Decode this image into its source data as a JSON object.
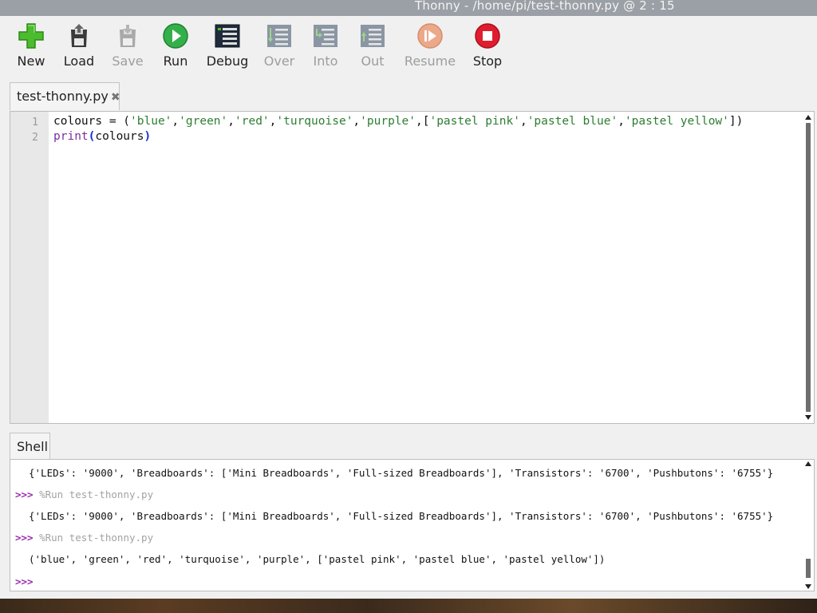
{
  "window": {
    "title": "Thonny  -  /home/pi/test-thonny.py  @  2 : 15"
  },
  "toolbar": {
    "buttons": [
      {
        "label": "New",
        "icon": "new-file-icon",
        "enabled": true
      },
      {
        "label": "Load",
        "icon": "load-icon",
        "enabled": true
      },
      {
        "label": "Save",
        "icon": "save-icon",
        "enabled": false
      },
      {
        "label": "Run",
        "icon": "run-icon",
        "enabled": true
      },
      {
        "label": "Debug",
        "icon": "debug-icon",
        "enabled": true
      },
      {
        "label": "Over",
        "icon": "step-over-icon",
        "enabled": false
      },
      {
        "label": "Into",
        "icon": "step-into-icon",
        "enabled": false
      },
      {
        "label": "Out",
        "icon": "step-out-icon",
        "enabled": false
      },
      {
        "label": "Resume",
        "icon": "resume-icon",
        "enabled": false
      },
      {
        "label": "Stop",
        "icon": "stop-icon",
        "enabled": true
      }
    ]
  },
  "editor": {
    "tab": {
      "label": "test-thonny.py",
      "close_glyph": "✖"
    },
    "lines": [
      {
        "number": "1",
        "text": "colours = ('blue','green','red','turquoise','purple',['pastel pink','pastel blue','pastel yellow'])"
      },
      {
        "number": "2",
        "text": "print(colours)"
      }
    ]
  },
  "shell": {
    "tab_label": "Shell",
    "lines": [
      {
        "type": "output",
        "text": "{'LEDs': '9000', 'Breadboards': ['Mini Breadboards', 'Full-sized Breadboards'], 'Transistors': '6700', 'Pushbutons': '6755'}"
      },
      {
        "type": "command",
        "prompt": ">>>",
        "text": "%Run test-thonny.py"
      },
      {
        "type": "output",
        "text": "{'LEDs': '9000', 'Breadboards': ['Mini Breadboards', 'Full-sized Breadboards'], 'Transistors': '6700', 'Pushbutons': '6755'}"
      },
      {
        "type": "command",
        "prompt": ">>>",
        "text": "%Run test-thonny.py"
      },
      {
        "type": "output",
        "text": "('blue', 'green', 'red', 'turquoise', 'purple', ['pastel pink', 'pastel blue', 'pastel yellow'])"
      },
      {
        "type": "command",
        "prompt": ">>>",
        "text": ""
      }
    ]
  },
  "colors": {
    "string": "#2e7d32",
    "keyword": "#7a2ea0",
    "bracket": "#1530c8",
    "prompt": "#9c27b0",
    "command": "#a3a3a3"
  }
}
